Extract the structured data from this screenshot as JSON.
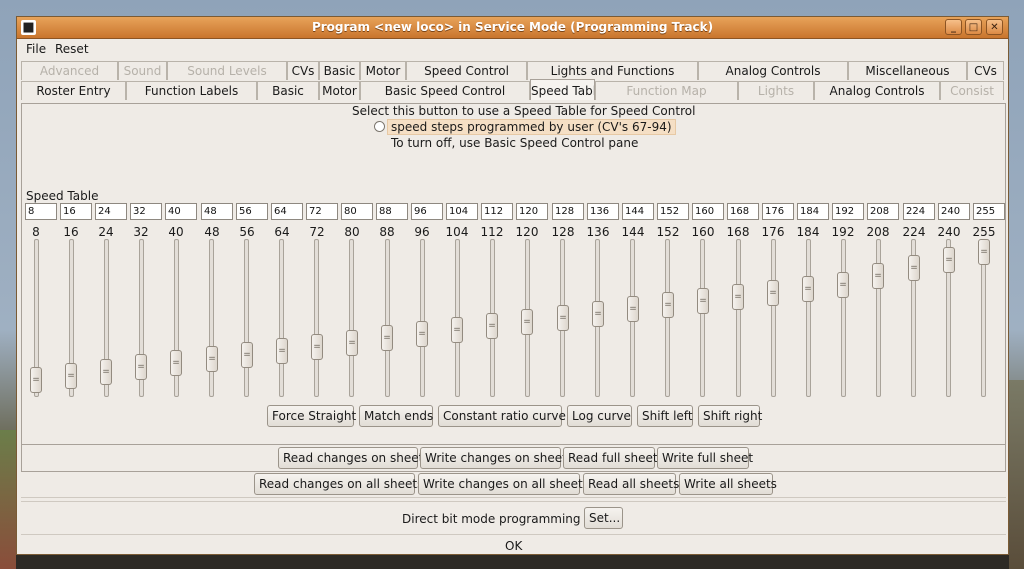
{
  "window": {
    "title": "Program <new loco> in Service Mode (Programming Track)"
  },
  "menu": {
    "file": "File",
    "reset": "Reset"
  },
  "tabs_row1": [
    {
      "label": "Advanced",
      "disabled": true
    },
    {
      "label": "Sound",
      "disabled": true
    },
    {
      "label": "Sound Levels",
      "disabled": true
    },
    {
      "label": "CVs",
      "disabled": false
    },
    {
      "label": "Basic",
      "disabled": false
    },
    {
      "label": "Motor",
      "disabled": false
    },
    {
      "label": "Speed Control",
      "disabled": false
    },
    {
      "label": "Lights and Functions",
      "disabled": false
    },
    {
      "label": "Analog Controls",
      "disabled": false
    },
    {
      "label": "Miscellaneous",
      "disabled": false
    },
    {
      "label": "CVs",
      "disabled": false
    }
  ],
  "tabs_row2": [
    {
      "label": "Roster Entry",
      "disabled": false
    },
    {
      "label": "Function Labels",
      "disabled": false
    },
    {
      "label": "Basic",
      "disabled": false
    },
    {
      "label": "Motor",
      "disabled": false
    },
    {
      "label": "Basic Speed Control",
      "disabled": false
    },
    {
      "label": "Speed Table",
      "disabled": false,
      "active": true
    },
    {
      "label": "Function Map",
      "disabled": true
    },
    {
      "label": "Lights",
      "disabled": true
    },
    {
      "label": "Analog Controls",
      "disabled": false
    },
    {
      "label": "Consist",
      "disabled": true
    }
  ],
  "speed_table": {
    "instruction": "Select this button to use a Speed Table for Speed Control",
    "radio_label": "speed steps programmed by user (CV's 67-94)",
    "radio_selected": false,
    "turn_off_text": "To turn off, use Basic Speed Control pane",
    "section_label": "Speed Table",
    "values": [
      8,
      16,
      24,
      32,
      40,
      48,
      56,
      64,
      72,
      80,
      88,
      96,
      104,
      112,
      120,
      128,
      136,
      144,
      152,
      160,
      168,
      176,
      184,
      192,
      208,
      224,
      240,
      255
    ],
    "slider_max": 255,
    "thumb_glyph": "="
  },
  "curve_buttons": [
    "Force Straight",
    "Match ends",
    "Constant ratio curve",
    "Log curve",
    "Shift left",
    "Shift right"
  ],
  "sheet_buttons": [
    "Read changes on sheet",
    "Write changes on sheet",
    "Read full sheet",
    "Write full sheet"
  ],
  "all_sheet_buttons": [
    "Read changes on all sheets",
    "Write changes on all sheets",
    "Read all sheets",
    "Write all sheets"
  ],
  "direct_bit": {
    "label": "Direct bit mode programming",
    "button": "Set..."
  },
  "ok_button": "OK"
}
